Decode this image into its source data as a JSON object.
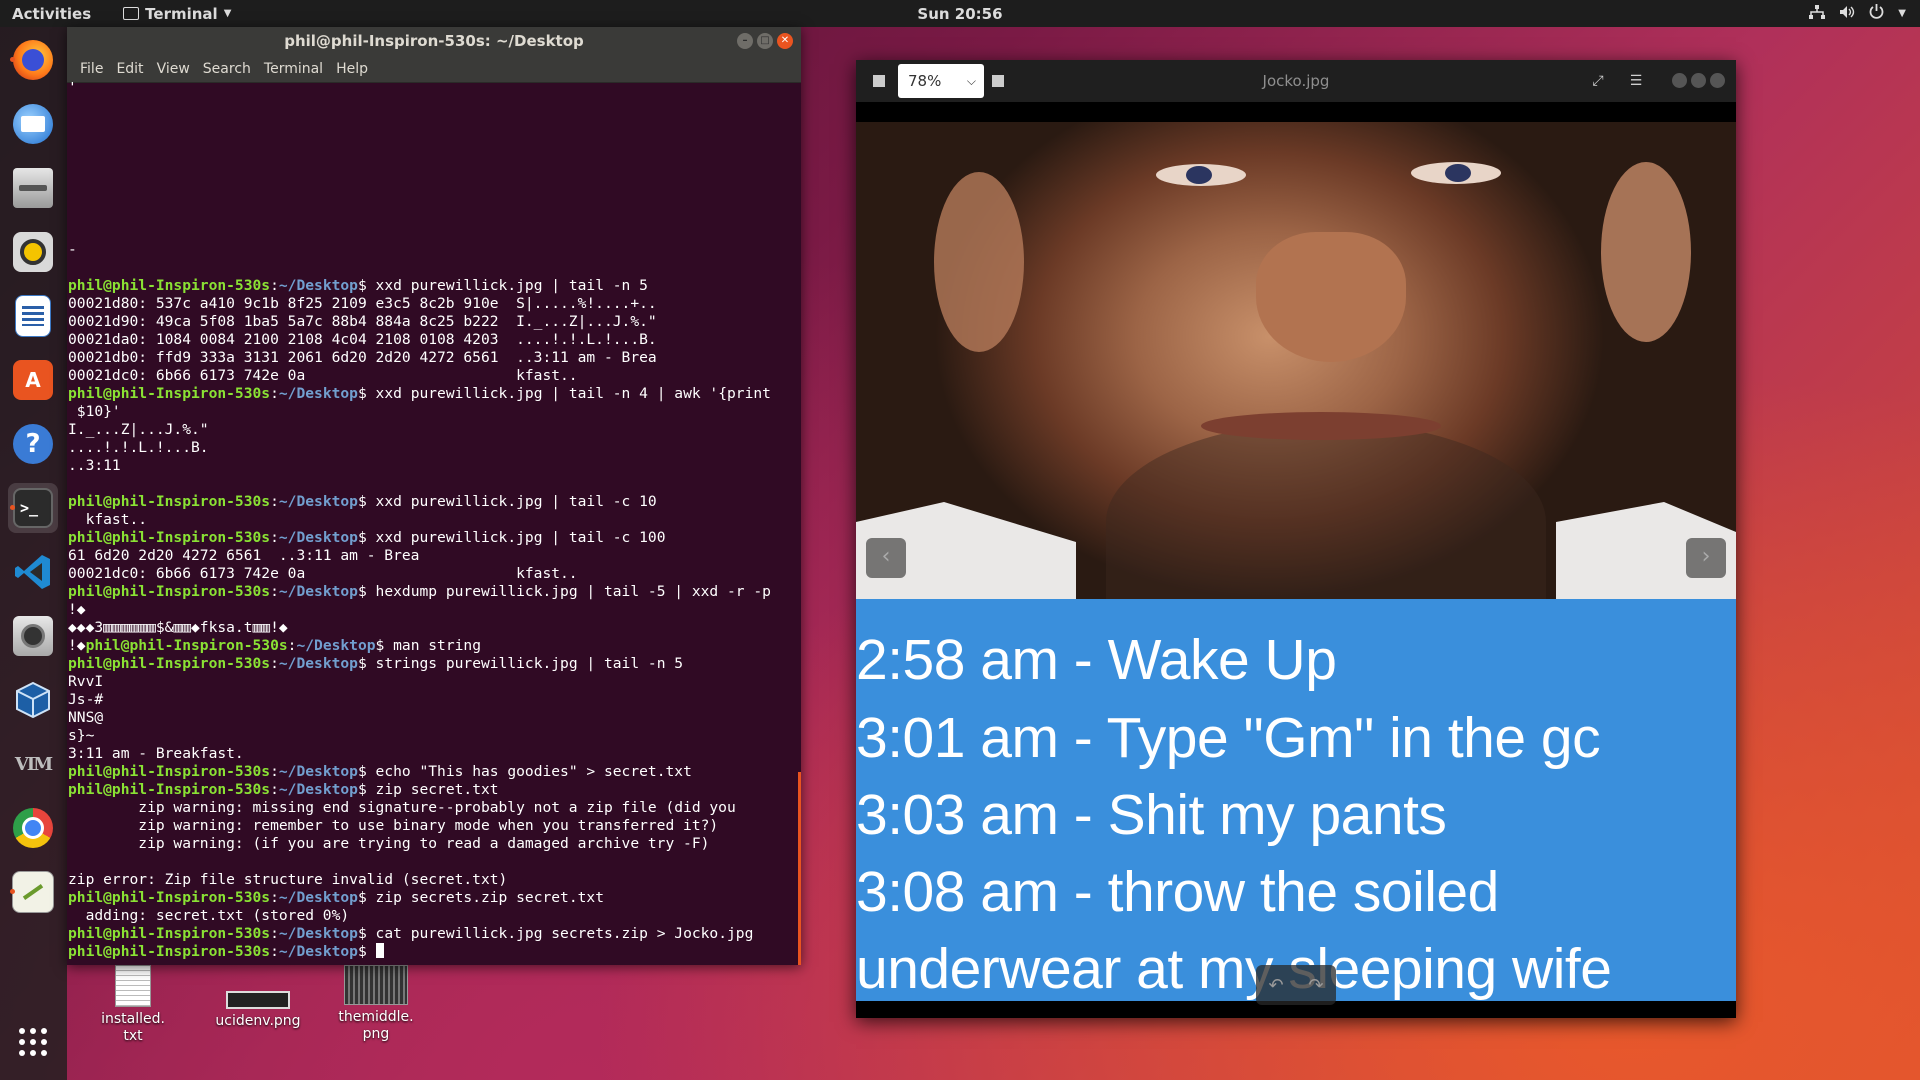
{
  "topbar": {
    "activities": "Activities",
    "app_menu": "Terminal",
    "clock": "Sun 20:56"
  },
  "dock": {
    "items": [
      "firefox-icon",
      "thunderbird-icon",
      "files-icon",
      "rhythmbox-icon",
      "writer-icon",
      "software-icon",
      "help-icon",
      "terminal-icon",
      "vscode-icon",
      "screenshot-icon",
      "virtualbox-icon",
      "vim-icon",
      "chromium-icon",
      "gedit-icon",
      "app-grid-icon"
    ]
  },
  "terminal": {
    "title": "phil@phil-Inspiron-530s: ~/Desktop",
    "menu": [
      "File",
      "Edit",
      "View",
      "Search",
      "Terminal",
      "Help"
    ],
    "prompt_user": "phil@phil-Inspiron-530s",
    "prompt_path": "~/Desktop",
    "lines": [
      {
        "t": "'"
      },
      {
        "t": ""
      },
      {
        "t": ""
      },
      {
        "t": ""
      },
      {
        "t": ""
      },
      {
        "t": ""
      },
      {
        "t": ""
      },
      {
        "t": ""
      },
      {
        "t": ""
      },
      {
        "t": "-"
      },
      {
        "t": ""
      },
      {
        "cmd": "xxd purewillick.jpg | tail -n 5"
      },
      {
        "t": "00021d80: 537c a410 9c1b 8f25 2109 e3c5 8c2b 910e  S|.....%!....+.."
      },
      {
        "t": "00021d90: 49ca 5f08 1ba5 5a7c 88b4 884a 8c25 b222  I._...Z|...J.%.\""
      },
      {
        "t": "00021da0: 1084 0084 2100 2108 4c04 2108 0108 4203  ....!.!.L.!...B."
      },
      {
        "t": "00021db0: ffd9 333a 3131 2061 6d20 2d20 4272 6561  ..3:11 am - Brea"
      },
      {
        "t": "00021dc0: 6b66 6173 742e 0a                        kfast.."
      },
      {
        "cmd": "xxd purewillick.jpg | tail -n 4 | awk '{print"
      },
      {
        "t": " $10}'"
      },
      {
        "t": "I._...Z|...J.%.\""
      },
      {
        "t": "....!.!.L.!...B."
      },
      {
        "t": "..3:11"
      },
      {
        "t": ""
      },
      {
        "cmd": "xxd purewillick.jpg | tail -c 10"
      },
      {
        "t": "  kfast.."
      },
      {
        "cmd": "xxd purewillick.jpg | tail -c 100"
      },
      {
        "t": "61 6d20 2d20 4272 6561  ..3:11 am - Brea"
      },
      {
        "t": "00021dc0: 6b66 6173 742e 0a                        kfast.."
      },
      {
        "cmd": "hexdump purewillick.jpg | tail -5 | xxd -r -p"
      },
      {
        "t": "!◆"
      },
      {
        "t": "◆◆◆3▥▥▥▥▥▥$&▥▥◆fksa.t▥▥!◆"
      },
      {
        "pre": "!◆",
        "cmd": "man string"
      },
      {
        "cmd": "strings purewillick.jpg | tail -n 5"
      },
      {
        "t": "RvvI"
      },
      {
        "t": "Js-#"
      },
      {
        "t": "NNS@"
      },
      {
        "t": "s}~"
      },
      {
        "t": "3:11 am - Breakfast."
      },
      {
        "cmd": "echo \"This has goodies\" > secret.txt"
      },
      {
        "cmd": "zip secret.txt"
      },
      {
        "t": "        zip warning: missing end signature--probably not a zip file (did you"
      },
      {
        "t": "        zip warning: remember to use binary mode when you transferred it?)"
      },
      {
        "t": "        zip warning: (if you are trying to read a damaged archive try -F)"
      },
      {
        "t": ""
      },
      {
        "t": "zip error: Zip file structure invalid (secret.txt)"
      },
      {
        "cmd": "zip secrets.zip secret.txt"
      },
      {
        "t": "  adding: secret.txt (stored 0%)"
      },
      {
        "cmd": "cat purewillick.jpg secrets.zip > Jocko.jpg"
      },
      {
        "cmd": "",
        "cursor": true
      }
    ]
  },
  "desktop_icons": [
    {
      "label1": "installed.",
      "label2": "txt"
    },
    {
      "label1": "ucidenv.png",
      "label2": ""
    },
    {
      "label1": "themiddle.",
      "label2": "png"
    }
  ],
  "viewer": {
    "zoom": "78%",
    "title": "Jocko.jpg",
    "caption_lines": [
      "2:58 am - Wake Up",
      "3:01 am - Type \"Gm\" in the gc",
      "3:03 am - Shit my pants",
      "3:08 am - throw the soiled",
      "underwear at my sleeping wife"
    ]
  },
  "colors": {
    "prompt_user": "#8ae234",
    "prompt_path": "#729fcf",
    "terminal_bg": "#300a24",
    "accent": "#e95420",
    "caption_bg": "#3a8fdc"
  }
}
